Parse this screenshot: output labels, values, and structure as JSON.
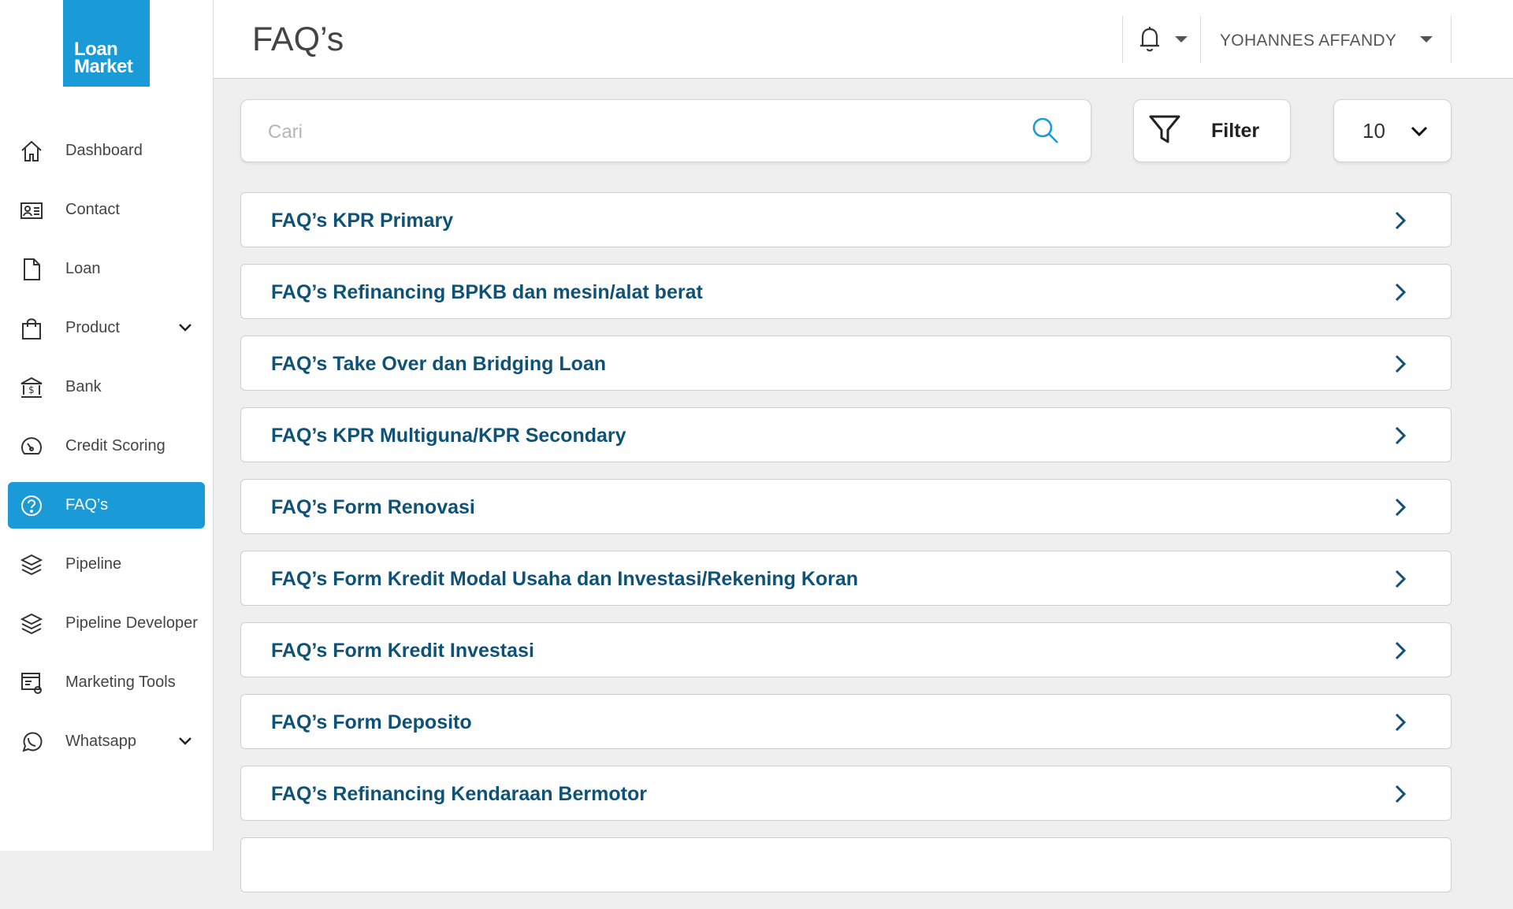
{
  "app": {
    "logo_line1": "Loan",
    "logo_line2": "Market",
    "brand_color": "#1b9ad8",
    "heading_color": "#0f5278"
  },
  "sidebar": {
    "items": [
      {
        "label": "Dashboard",
        "icon": "home-icon"
      },
      {
        "label": "Contact",
        "icon": "contact-card-icon"
      },
      {
        "label": "Loan",
        "icon": "document-icon"
      },
      {
        "label": "Product",
        "icon": "shopping-bag-icon",
        "expandable": true
      },
      {
        "label": "Bank",
        "icon": "bank-icon"
      },
      {
        "label": "Credit Scoring",
        "icon": "gauge-icon"
      },
      {
        "label": "FAQ’s",
        "icon": "question-circle-icon",
        "active": true
      },
      {
        "label": "Pipeline",
        "icon": "layers-icon"
      },
      {
        "label": "Pipeline Developer",
        "icon": "layers-icon"
      },
      {
        "label": "Marketing Tools",
        "icon": "settings-window-icon"
      },
      {
        "label": "Whatsapp",
        "icon": "whatsapp-icon",
        "expandable": true
      }
    ]
  },
  "header": {
    "title": "FAQ’s",
    "user_name": "YOHANNES AFFANDY"
  },
  "toolbar": {
    "search_placeholder": "Cari",
    "search_value": "",
    "filter_label": "Filter",
    "page_size": "10"
  },
  "faqs": [
    "FAQ’s KPR Primary",
    "FAQ’s Refinancing BPKB dan mesin/alat berat",
    "FAQ’s Take Over dan Bridging Loan",
    "FAQ’s KPR Multiguna/KPR Secondary",
    "FAQ’s Form Renovasi",
    "FAQ’s Form Kredit Modal Usaha dan Investasi/Rekening Koran",
    "FAQ’s Form Kredit Investasi",
    "FAQ’s Form Deposito",
    "FAQ’s Refinancing Kendaraan Bermotor"
  ]
}
